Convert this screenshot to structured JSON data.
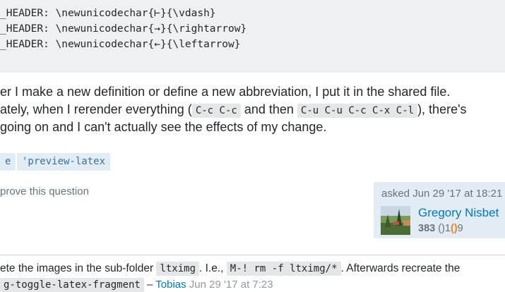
{
  "code_block": {
    "lines": [
      "_HEADER: \\newunicodechar{⊢}{\\vdash}",
      "_HEADER: \\newunicodechar{→}{\\rightarrow}",
      "_HEADER: \\newunicodechar{←}{\\leftarrow}"
    ]
  },
  "paragraph": {
    "line1": "er I make a new definition or define a new abbreviation, I put it in the shared file.",
    "line2_pre": "ately, when I rerender everything (",
    "line2_code1": "C-c C-c",
    "line2_mid": " and then ",
    "line2_code2": "C-u C-u C-c C-x C-l",
    "line2_post": "), there's",
    "line3": "going on and I can't actually see the effects of my change."
  },
  "tags": [
    "e",
    "'preview-latex"
  ],
  "improve_link": "prove this question",
  "asked": {
    "label": "asked Jun 29 '17 at 18:21",
    "user_name": "Gregory Nisbet",
    "reputation": "383",
    "badges_prefix": "(",
    "badges_mid": ")1",
    "badge_paren_open": "(",
    "badge_paren_close": ")",
    "badges_suffix": "9"
  },
  "comment": {
    "text_pre": "ete the images in the sub-folder ",
    "code1": "ltximg",
    "text_mid": ". I.e., ",
    "code2": "M-! rm -f ltximg/*",
    "text_post": ". Afterwards recreate the",
    "line2_code": "g-toggle-latex-fragment",
    "line2_sep": " – ",
    "line2_user": "Tobias",
    "line2_date": " Jun 29 '17 at 7:23"
  },
  "colors": {
    "code_bg": "#eff0f1",
    "tag_bg": "#e1ecf4",
    "tag_fg": "#39739d",
    "link": "#0077cc",
    "user_card_bg": "#e1ecf4"
  }
}
